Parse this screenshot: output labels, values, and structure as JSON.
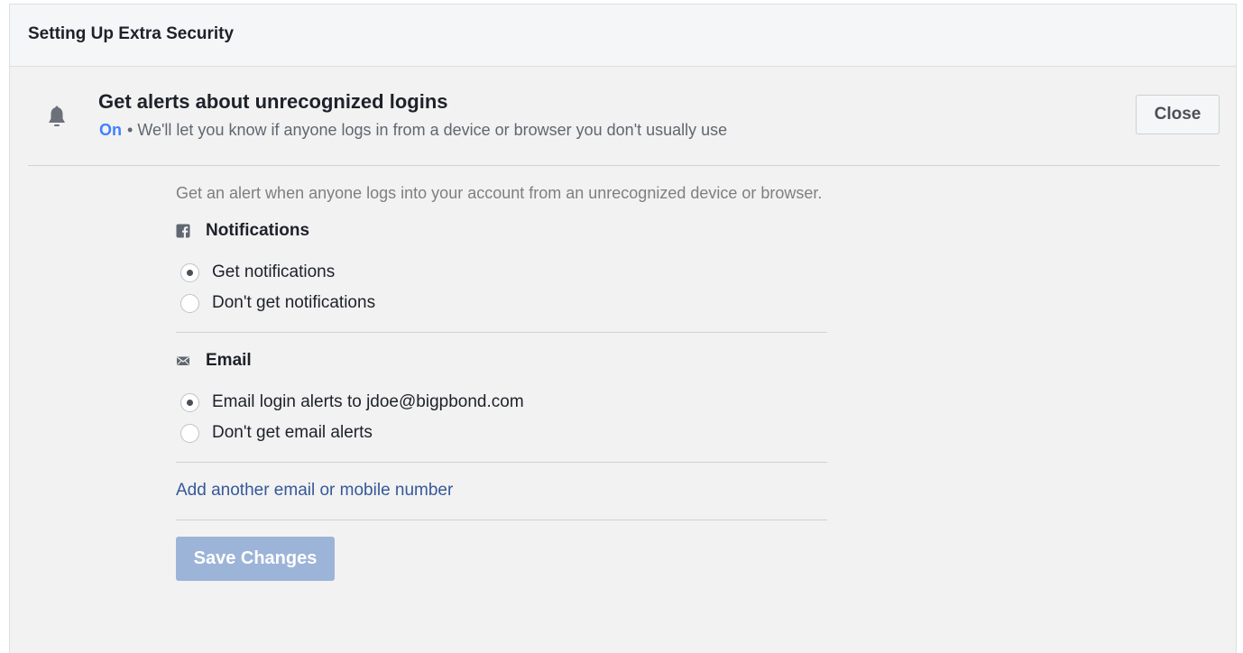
{
  "panel": {
    "title": "Setting Up Extra Security"
  },
  "alert_setting": {
    "icon": "bell-icon",
    "title": "Get alerts about unrecognized logins",
    "status": "On",
    "separator": "•",
    "description": "We'll let you know if anyone logs in from a device or browser you don't usually use",
    "close_label": "Close"
  },
  "details": {
    "intro": "Get an alert when anyone logs into your account from an unrecognized device or browser.",
    "notifications": {
      "icon": "facebook-icon",
      "heading": "Notifications",
      "options": [
        {
          "label": "Get notifications",
          "selected": true
        },
        {
          "label": "Don't get notifications",
          "selected": false
        }
      ]
    },
    "email": {
      "icon": "envelope-icon",
      "heading": "Email",
      "options": [
        {
          "label": "Email login alerts to jdoe@bigpbond.com",
          "selected": true
        },
        {
          "label": "Don't get email alerts",
          "selected": false
        }
      ]
    },
    "add_contact_link": "Add another email or mobile number",
    "save_label": "Save Changes",
    "save_enabled": false
  },
  "colors": {
    "status_on": "#4080ff",
    "link": "#365899",
    "save_button_disabled": "#9cb4d8"
  }
}
